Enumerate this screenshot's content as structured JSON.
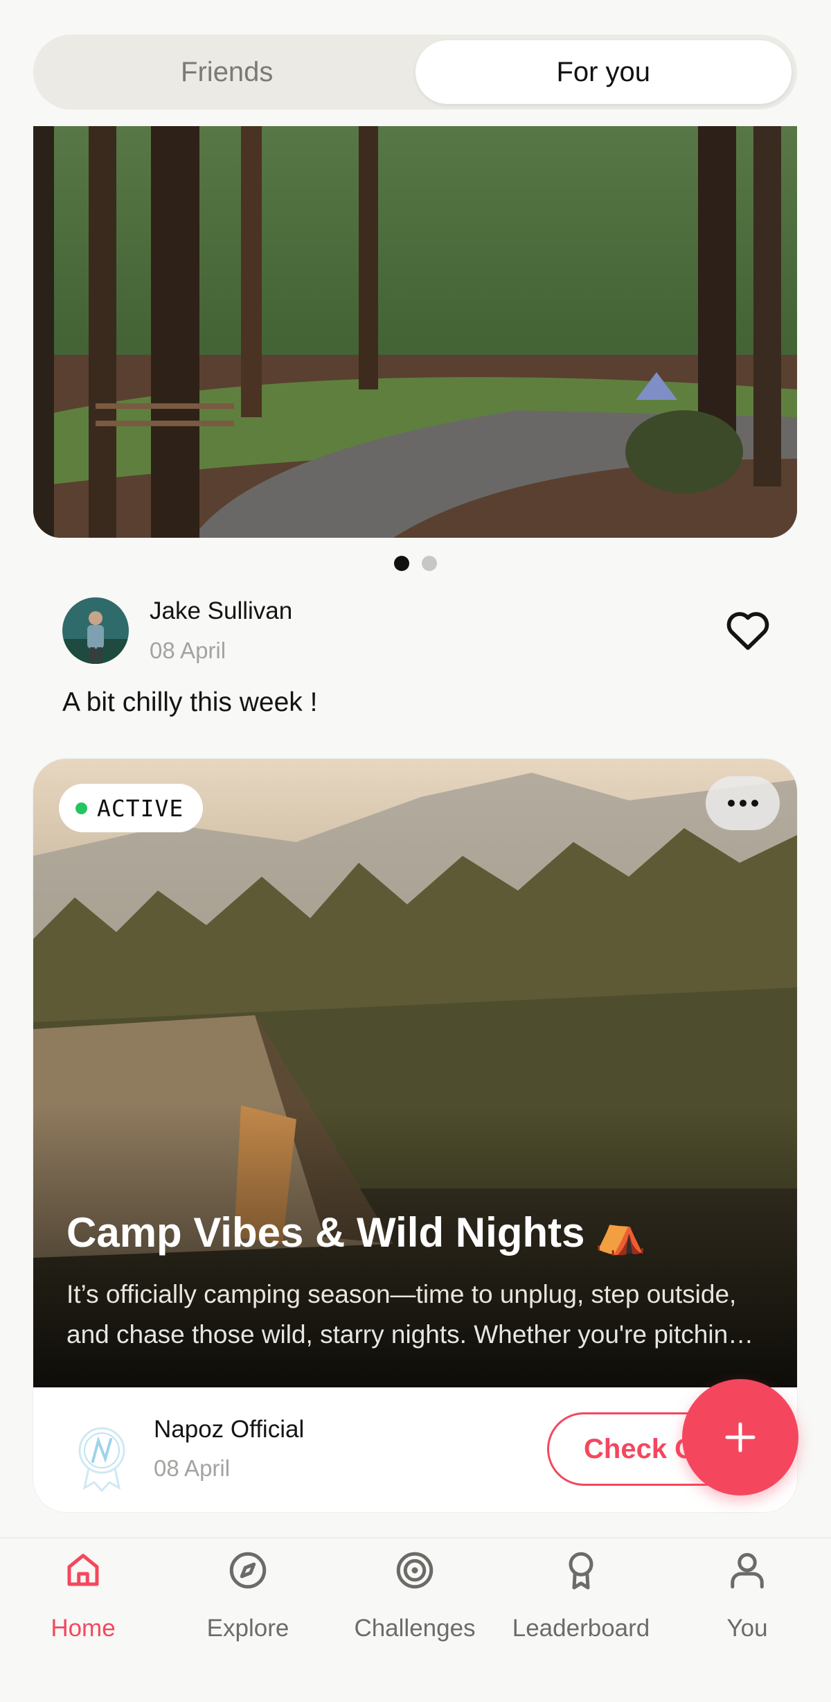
{
  "tabs": [
    {
      "label": "Friends",
      "active": false
    },
    {
      "label": "For you",
      "active": true
    }
  ],
  "carousel": {
    "total_pages": 2,
    "current_page": 1
  },
  "post": {
    "author": "Jake Sullivan",
    "date": "08 April",
    "text": "A bit chilly this week !",
    "liked": false
  },
  "event": {
    "status": "ACTIVE",
    "status_color": "#22c55e",
    "title": "Camp Vibes & Wild Nights",
    "title_emoji": "⛺",
    "description": "It’s officially camping season—time to unplug, step outside, and chase those wild, starry nights. Whether you're pitching a tent or sitting by the fire.",
    "organizer": "Napoz Official",
    "organizer_date": "08 April",
    "cta_label": "Check Out"
  },
  "fab": {
    "icon": "plus-icon"
  },
  "nav": {
    "items": [
      {
        "label": "Home",
        "icon": "home-icon",
        "active": true
      },
      {
        "label": "Explore",
        "icon": "compass-icon",
        "active": false
      },
      {
        "label": "Challenges",
        "icon": "target-icon",
        "active": false
      },
      {
        "label": "Leaderboard",
        "icon": "award-icon",
        "active": false
      },
      {
        "label": "You",
        "icon": "user-icon",
        "active": false
      }
    ]
  },
  "colors": {
    "accent": "#f4475e",
    "background": "#f8f8f6",
    "inactive": "#6b6b68"
  }
}
